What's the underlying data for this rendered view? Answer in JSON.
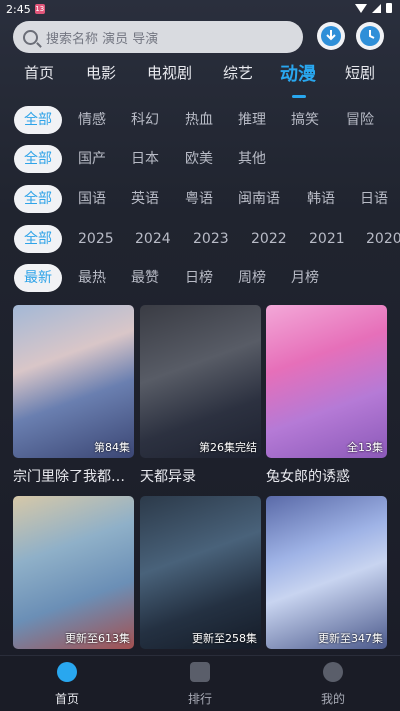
{
  "status_bar": {
    "time": "2:45",
    "notif_badge": "13"
  },
  "search": {
    "placeholder": "搜索名称 演员 导演"
  },
  "header": {
    "download_icon": "download-icon",
    "history_icon": "history-icon"
  },
  "category_tabs": [
    {
      "label": "首页",
      "active": false
    },
    {
      "label": "电影",
      "active": false
    },
    {
      "label": "电视剧",
      "active": false
    },
    {
      "label": "综艺",
      "active": false
    },
    {
      "label": "动漫",
      "active": true
    },
    {
      "label": "短剧",
      "active": false
    }
  ],
  "filters": {
    "genre": [
      "全部",
      "情感",
      "科幻",
      "热血",
      "推理",
      "搞笑",
      "冒险"
    ],
    "region": [
      "全部",
      "国产",
      "日本",
      "欧美",
      "其他"
    ],
    "language": [
      "全部",
      "国语",
      "英语",
      "粤语",
      "闽南语",
      "韩语",
      "日语"
    ],
    "year": [
      "全部",
      "2025",
      "2024",
      "2023",
      "2022",
      "2021",
      "2020"
    ],
    "sort": [
      "最新",
      "最热",
      "最赞",
      "日榜",
      "周榜",
      "月榜"
    ]
  },
  "items": [
    {
      "title": "宗门里除了我都是卧底",
      "episode": "第84集"
    },
    {
      "title": "天都异录",
      "episode": "第26集完结"
    },
    {
      "title": "兔女郎的诱惑",
      "episode": "全13集"
    },
    {
      "title": "",
      "episode": "更新至613集"
    },
    {
      "title": "",
      "episode": "更新至258集"
    },
    {
      "title": "",
      "episode": "更新至347集"
    }
  ],
  "bottom_nav": [
    {
      "label": "首页",
      "active": true,
      "icon": "home-icon"
    },
    {
      "label": "排行",
      "active": false,
      "icon": "ranking-icon"
    },
    {
      "label": "我的",
      "active": false,
      "icon": "profile-icon"
    }
  ],
  "colors": {
    "accent": "#29a7ef",
    "background": "#1b1d29",
    "chip_selected_bg": "#f1f2f5"
  }
}
